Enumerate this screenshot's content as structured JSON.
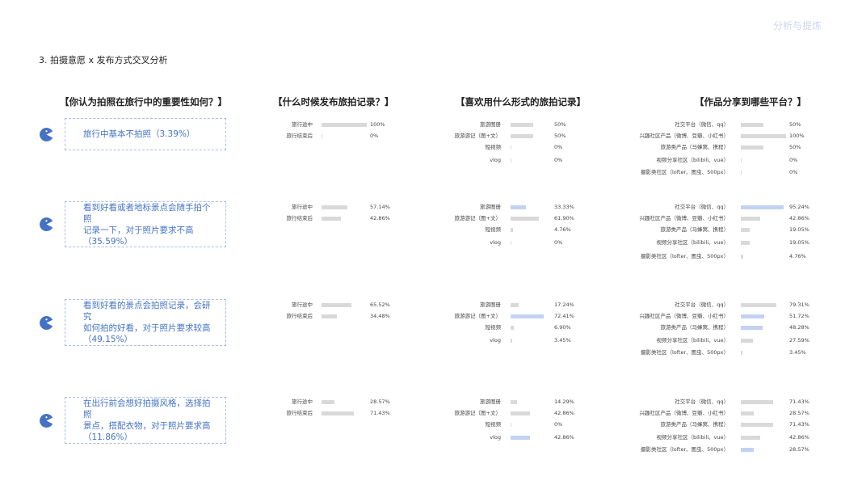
{
  "header": {
    "corner_label": "分析与提炼",
    "section_title": "3. 拍摄意愿 x 发布方式交叉分析"
  },
  "questions": {
    "q1": "【你认为拍照在旅行中的重要性如何？】",
    "q2": "【什么时候发布旅拍记录？】",
    "q3": "【喜欢用什么形式的旅拍记录】",
    "q4": "【作品分享到哪些平台？】"
  },
  "colors": {
    "bar": "#d9d9d9",
    "bar_highlight": "#c3d2f2",
    "accent": "#4472c4"
  },
  "chart_data": [
    {
      "type": "bar",
      "title": "【什么时候发布旅拍记录？】",
      "categories": [
        "旅行途中",
        "旅行结束后"
      ],
      "xlim": [
        0,
        100
      ],
      "series": [
        {
          "name": "旅行中基本不拍照（3.39%）",
          "values": [
            100,
            0
          ],
          "labels": [
            "100%",
            "0%"
          ]
        },
        {
          "name": "看到好看或者地标景点会随手拍个照记录一下，对于照片要求不高（35.59%）",
          "values": [
            57.14,
            42.86
          ],
          "labels": [
            "57.14%",
            "42.86%"
          ]
        },
        {
          "name": "看到好看的景点会拍照记录，会研究如何拍的好看，对于照片要求较高（49.15%）",
          "values": [
            65.52,
            34.48
          ],
          "labels": [
            "65.52%",
            "34.48%"
          ]
        },
        {
          "name": "在出行前会想好拍摄风格，选择拍照景点，搭配衣物，对于照片要求高（11.86%）",
          "values": [
            28.57,
            71.43
          ],
          "labels": [
            "28.57%",
            "71.43%"
          ]
        }
      ]
    },
    {
      "type": "bar",
      "title": "【喜欢用什么形式的旅拍记录】",
      "categories": [
        "旅游图册",
        "旅游游记（图+文）",
        "短视频",
        "vlog"
      ],
      "xlim": [
        0,
        100
      ],
      "series": [
        {
          "name": "旅行中基本不拍照（3.39%）",
          "values": [
            50,
            50,
            0,
            0
          ],
          "labels": [
            "50%",
            "50%",
            "0%",
            "0%"
          ]
        },
        {
          "name": "看到好看或者地标景点会随手拍个照记录一下，对于照片要求不高（35.59%）",
          "values": [
            33.33,
            61.9,
            4.76,
            0
          ],
          "labels": [
            "33.33%",
            "61.90%",
            "4.76%",
            "0%"
          ]
        },
        {
          "name": "看到好看的景点会拍照记录，会研究如何拍的好看，对于照片要求较高（49.15%）",
          "values": [
            17.24,
            72.41,
            6.9,
            3.45
          ],
          "labels": [
            "17.24%",
            "72.41%",
            "6.90%",
            "3.45%"
          ]
        },
        {
          "name": "在出行前会想好拍摄风格，选择拍照景点，搭配衣物，对于照片要求高（11.86%）",
          "values": [
            14.29,
            42.86,
            0,
            42.86
          ],
          "labels": [
            "14.29%",
            "42.86%",
            "0%",
            "42.86%"
          ]
        }
      ]
    },
    {
      "type": "bar",
      "title": "【作品分享到哪些平台？】",
      "categories": [
        "社交平台（微信、qq）",
        "兴趣社区产品（微博、豆瓣、小红书）",
        "旅游类产品（马蜂窝、携程）",
        "视频分享社区（bilibili、vue）",
        "摄影类社区（lofter、图虫、500px）"
      ],
      "xlim": [
        0,
        100
      ],
      "series": [
        {
          "name": "旅行中基本不拍照（3.39%）",
          "values": [
            50,
            100,
            50,
            0,
            0
          ],
          "labels": [
            "50%",
            "100%",
            "50%",
            "0%",
            "0%"
          ]
        },
        {
          "name": "看到好看或者地标景点会随手拍个照记录一下，对于照片要求不高（35.59%）",
          "values": [
            95.24,
            42.86,
            19.05,
            19.05,
            4.76
          ],
          "labels": [
            "95.24%",
            "42.86%",
            "19.05%",
            "19.05%",
            "4.76%"
          ]
        },
        {
          "name": "看到好看的景点会拍照记录，会研究如何拍的好看，对于照片要求较高（49.15%）",
          "values": [
            79.31,
            51.72,
            48.28,
            27.59,
            3.45
          ],
          "labels": [
            "79.31%",
            "51.72%",
            "48.28%",
            "27.59%",
            "3.45%"
          ]
        },
        {
          "name": "在出行前会想好拍摄风格，选择拍照景点，搭配衣物，对于照片要求高（11.86%）",
          "values": [
            71.43,
            28.57,
            71.43,
            42.86,
            28.57
          ],
          "labels": [
            "71.43%",
            "28.57%",
            "71.43%",
            "42.86%",
            "28.57%"
          ]
        }
      ]
    }
  ],
  "respondent_groups": [
    {
      "lines": [
        "旅行中基本不拍照（3.39%）"
      ],
      "highlights": {
        "when": [],
        "form": [],
        "platform": []
      }
    },
    {
      "lines": [
        "看到好看或者地标景点会随手拍个照",
        "记录一下，对于照片要求不高",
        "（35.59%）"
      ],
      "highlights": {
        "when": [],
        "form": [
          0
        ],
        "platform": [
          0
        ]
      }
    },
    {
      "lines": [
        "看到好看的景点会拍照记录，会研究",
        "如何拍的好看，对于照片要求较高",
        "（49.15%）"
      ],
      "highlights": {
        "when": [],
        "form": [
          1
        ],
        "platform": [
          1,
          2
        ]
      }
    },
    {
      "lines": [
        "在出行前会想好拍摄风格，选择拍照",
        "景点，搭配衣物，对于照片要求高",
        "（11.86%）"
      ],
      "highlights": {
        "when": [],
        "form": [
          3
        ],
        "platform": [
          4
        ]
      }
    }
  ]
}
